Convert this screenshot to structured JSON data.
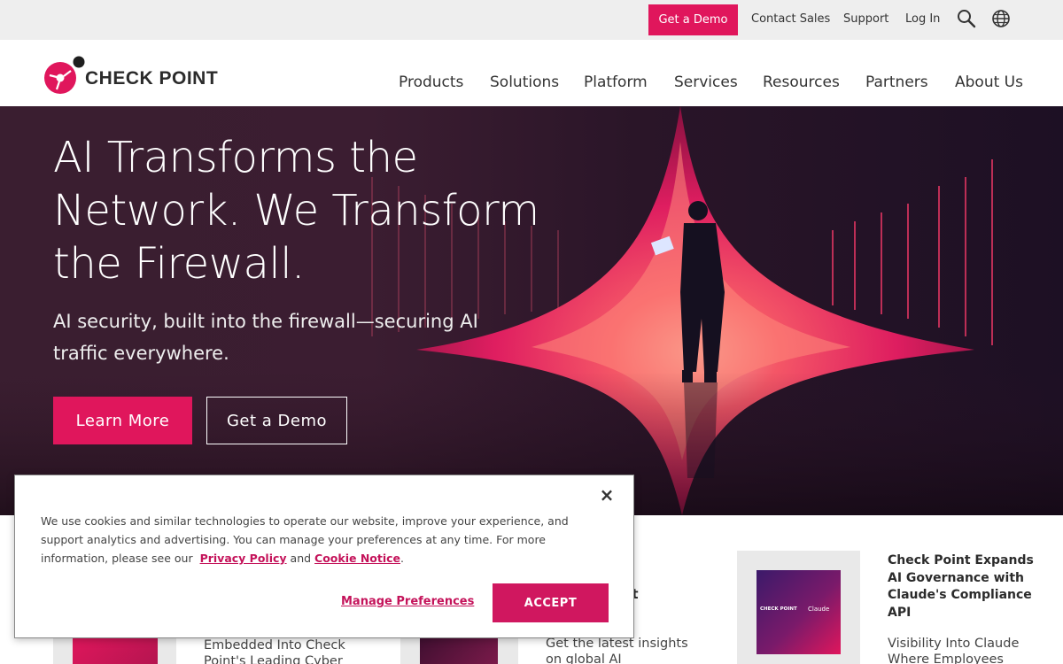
{
  "utility_bar": {
    "demo_label": "Get a Demo",
    "contact_sales": "Contact Sales",
    "support": "Support",
    "log_in": "Log In",
    "icons": [
      "search-icon",
      "globe-icon"
    ]
  },
  "brand": {
    "name": "CHECK POINT",
    "accent": "#e0165c"
  },
  "nav": {
    "items": [
      {
        "label": "Products"
      },
      {
        "label": "Solutions"
      },
      {
        "label": "Platform"
      },
      {
        "label": "Services"
      },
      {
        "label": "Resources"
      },
      {
        "label": "Partners"
      },
      {
        "label": "About Us"
      }
    ]
  },
  "hero": {
    "title": "AI Transforms the Network. We Transform the Firewall.",
    "subtitle": "AI security, built into the firewall—securing AI traffic everywhere.",
    "learn_more": "Learn More",
    "get_demo": "Get a Demo"
  },
  "cards": [
    {
      "text": "Embedded Into Check Point's Leading Cyber"
    },
    {
      "title": "rt",
      "text": "Get the latest insights on global AI"
    },
    {
      "title": "Check Point Expands AI Governance with Claude's Compliance API",
      "text": "Visibility Into Claude Where Employees",
      "thumb_brands": [
        "CHECK POINT",
        "Claude"
      ]
    }
  ],
  "cookie": {
    "text_before": "We use cookies and similar technologies to operate our website, improve your experience, and support analytics and advertising. You can manage your preferences at any time. For more information, please see our",
    "privacy_link": "Privacy Policy",
    "and": "and",
    "cookie_link": "Cookie Notice",
    "period": ".",
    "manage": "Manage Preferences",
    "accept": "ACCEPT",
    "close": "×"
  }
}
